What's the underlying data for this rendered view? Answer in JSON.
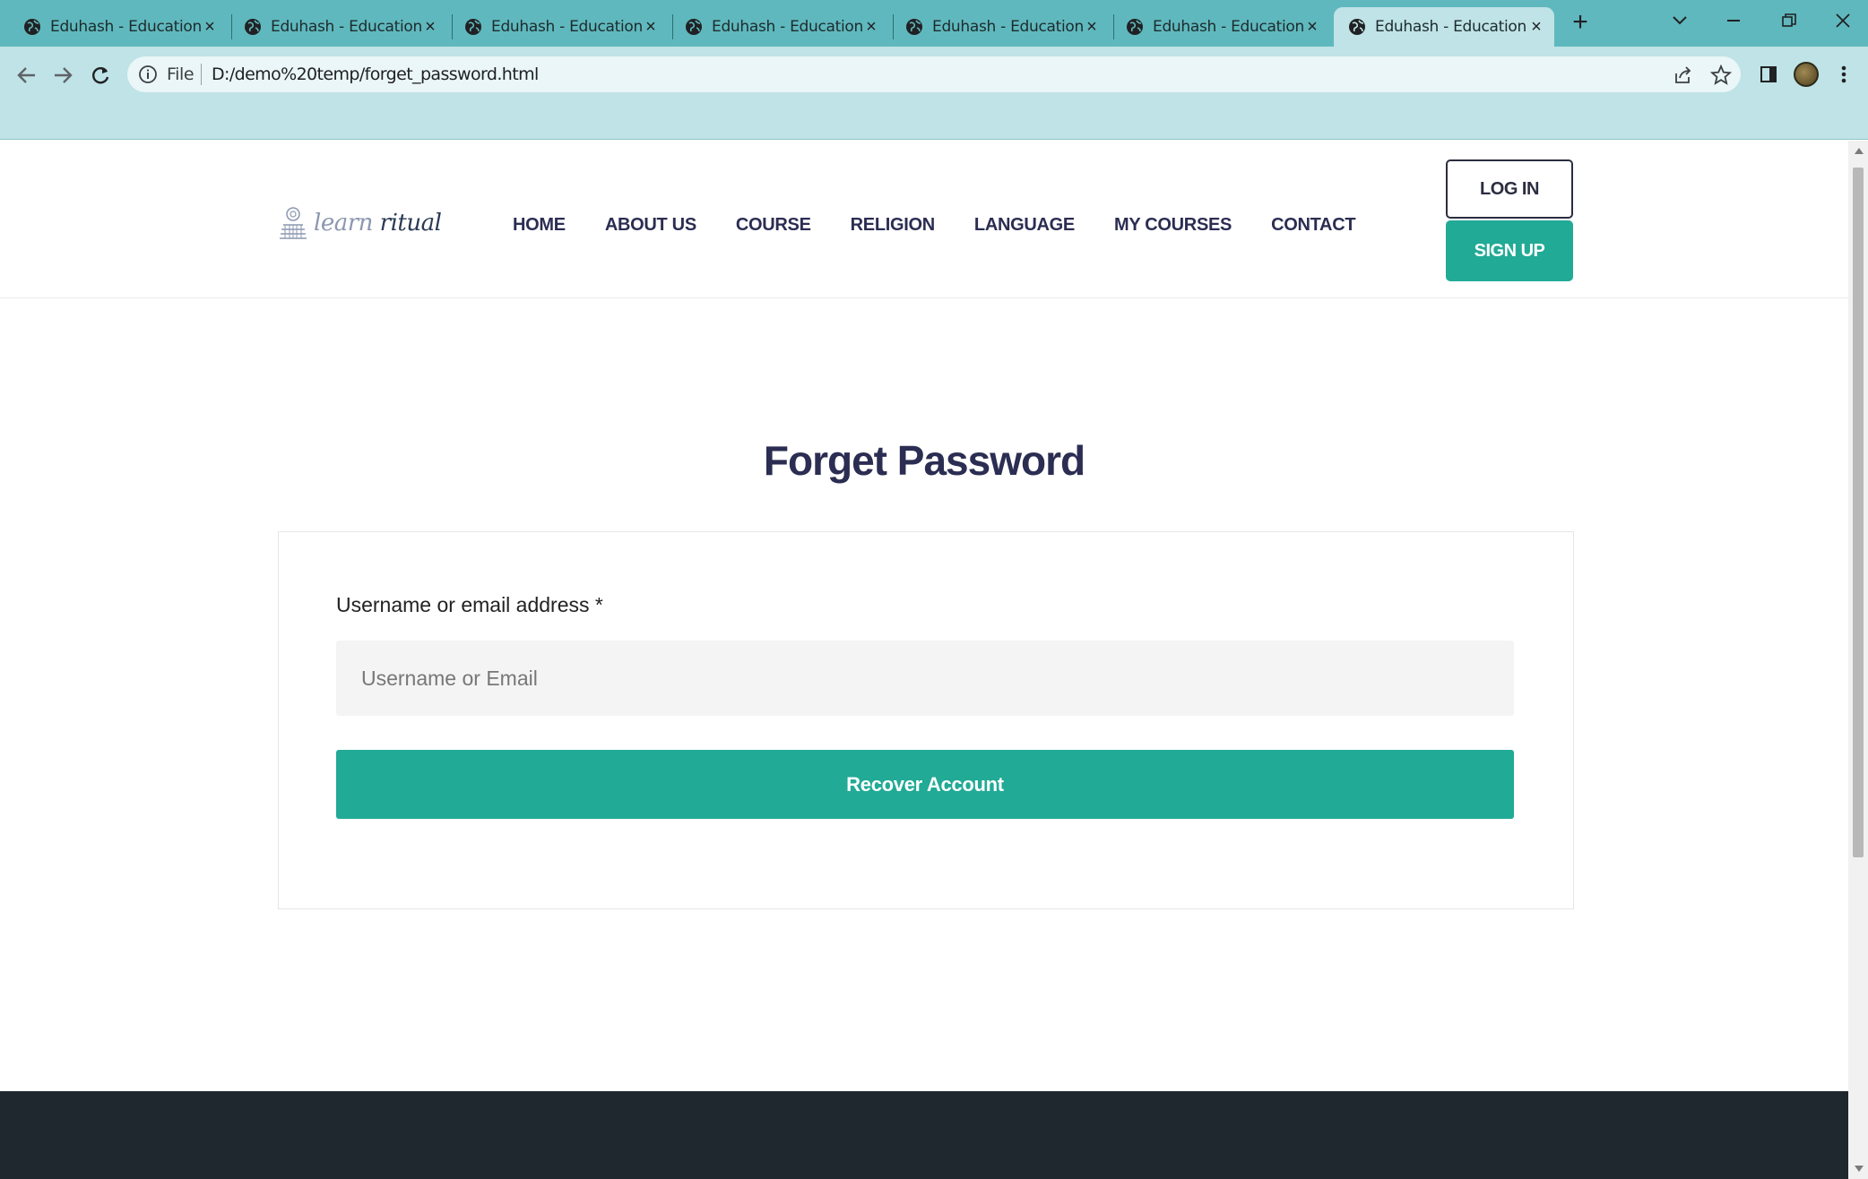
{
  "browser": {
    "tabs": [
      {
        "title": "Eduhash - Education LMS",
        "active": false
      },
      {
        "title": "Eduhash - Education LMS",
        "active": false
      },
      {
        "title": "Eduhash - Education LMS",
        "active": false
      },
      {
        "title": "Eduhash - Education LMS",
        "active": false
      },
      {
        "title": "Eduhash - Education LMS",
        "active": false
      },
      {
        "title": "Eduhash - Education LMS",
        "active": false
      },
      {
        "title": "Eduhash - Education LMS",
        "active": true
      }
    ],
    "address": {
      "scheme_label": "File",
      "url": "D:/demo%20temp/forget_password.html"
    },
    "colors": {
      "tabbar": "#5fb8bd",
      "toolbar": "#bfe3e6"
    }
  },
  "site": {
    "logo": {
      "part1": "learn",
      "part2": "ritual"
    },
    "nav": [
      "HOME",
      "ABOUT US",
      "COURSE",
      "RELIGION",
      "LANGUAGE",
      "MY COURSES",
      "CONTACT"
    ],
    "login_label": "LOG IN",
    "signup_label": "SIGN UP",
    "accent_color": "#21aa96"
  },
  "form": {
    "title": "Forget Password",
    "field_label": "Username or email address *",
    "field_placeholder": "Username or Email",
    "field_value": "",
    "submit_label": "Recover Account"
  }
}
